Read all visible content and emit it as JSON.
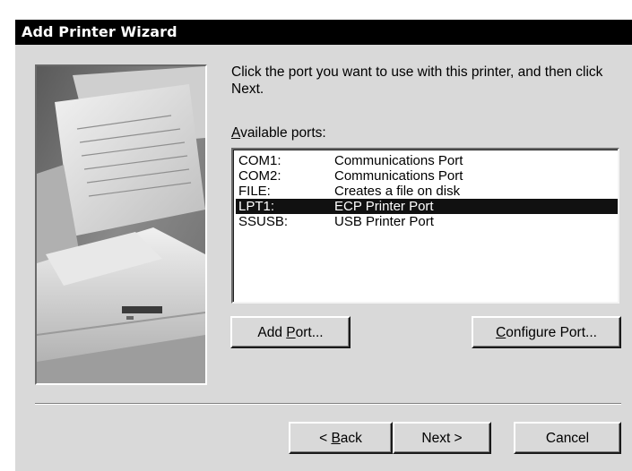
{
  "window": {
    "title": "Add Printer Wizard"
  },
  "instruction": "Click the port you want to use with this printer, and then click Next.",
  "ports_label": {
    "accel": "A",
    "rest": "vailable ports:"
  },
  "ports": [
    {
      "name": "COM1:",
      "description": "Communications Port",
      "selected": false
    },
    {
      "name": "COM2:",
      "description": "Communications Port",
      "selected": false
    },
    {
      "name": "FILE:",
      "description": "Creates a file on disk",
      "selected": false
    },
    {
      "name": "LPT1:",
      "description": "ECP Printer Port",
      "selected": true
    },
    {
      "name": "SSUSB:",
      "description": "USB Printer Port",
      "selected": false
    }
  ],
  "buttons": {
    "add_port": {
      "before": "Add ",
      "accel": "P",
      "after": "ort..."
    },
    "configure_port": {
      "before": "",
      "accel": "C",
      "after": "onfigure Port..."
    },
    "back": {
      "before": "< ",
      "accel": "B",
      "after": "ack"
    },
    "next": "Next >",
    "cancel": "Cancel"
  },
  "colors": {
    "titlebar": "#000000",
    "dialog_background": "#d9d9d9",
    "selection": "#111111"
  }
}
